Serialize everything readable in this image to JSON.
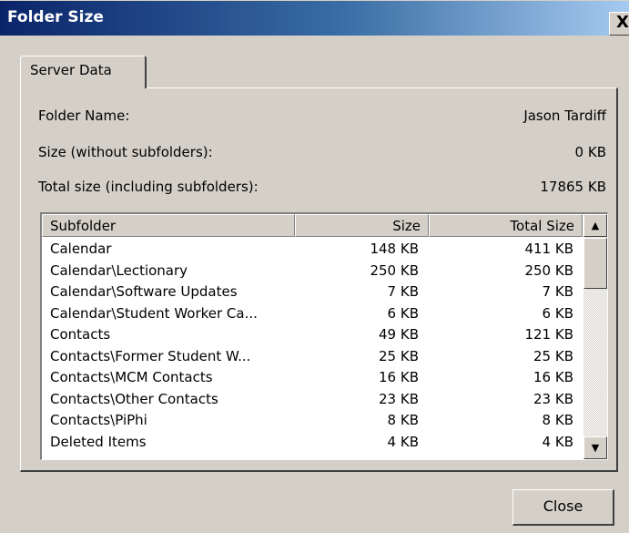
{
  "window": {
    "title": "Folder Size",
    "close_glyph": "X"
  },
  "tabs": [
    {
      "label": "Server Data"
    }
  ],
  "properties": {
    "folder_name_label": "Folder Name:",
    "folder_name_value": "Jason Tardiff",
    "size_label": "Size (without subfolders):",
    "size_value": "0 KB",
    "total_label": "Total size (including subfolders):",
    "total_value": "17865 KB"
  },
  "table": {
    "columns": [
      "Subfolder",
      "Size",
      "Total Size"
    ],
    "rows": [
      {
        "name": "Calendar",
        "size": "148 KB",
        "total": "411 KB"
      },
      {
        "name": "Calendar\\Lectionary",
        "size": "250 KB",
        "total": "250 KB"
      },
      {
        "name": "Calendar\\Software Updates",
        "size": "7 KB",
        "total": "7 KB"
      },
      {
        "name": "Calendar\\Student Worker Ca...",
        "size": "6 KB",
        "total": "6 KB"
      },
      {
        "name": "Contacts",
        "size": "49 KB",
        "total": "121 KB"
      },
      {
        "name": "Contacts\\Former Student W...",
        "size": "25 KB",
        "total": "25 KB"
      },
      {
        "name": "Contacts\\MCM Contacts",
        "size": "16 KB",
        "total": "16 KB"
      },
      {
        "name": "Contacts\\Other Contacts",
        "size": "23 KB",
        "total": "23 KB"
      },
      {
        "name": "Contacts\\PiPhi",
        "size": "8 KB",
        "total": "8 KB"
      },
      {
        "name": "Deleted Items",
        "size": "4 KB",
        "total": "4 KB"
      }
    ]
  },
  "scrollbar": {
    "up_icon": "scroll-up-arrow-icon",
    "down_icon": "scroll-down-arrow-icon"
  },
  "buttons": {
    "close_label": "Close"
  },
  "colors": {
    "titlebar_start": "#0a246a",
    "titlebar_end": "#a6caf0",
    "face": "#d4d0c8"
  }
}
